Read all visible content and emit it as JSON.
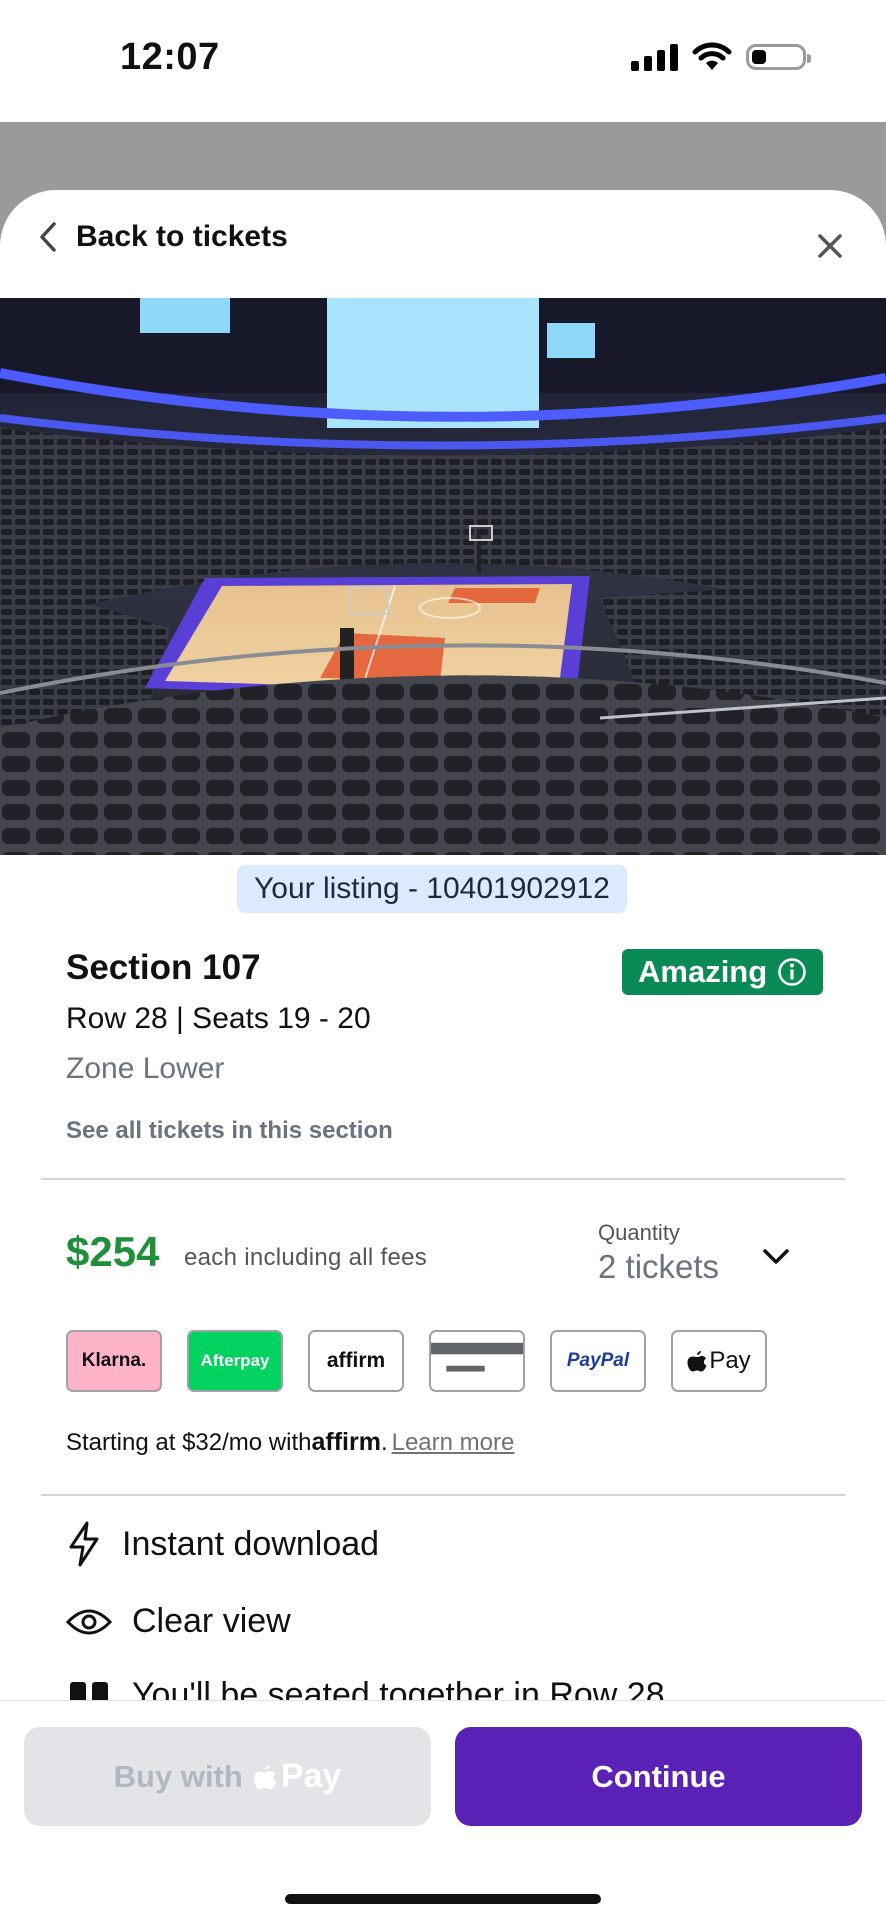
{
  "status_bar": {
    "time": "12:07"
  },
  "header": {
    "back_label": "Back to tickets"
  },
  "listing": {
    "pill_text": "Your listing - 10401902912",
    "section": "Section 107",
    "badge": "Amazing",
    "row_seats": "Row 28 | Seats 19 - 20",
    "zone": "Zone Lower",
    "see_all": "See all tickets in this section"
  },
  "pricing": {
    "price": "$254",
    "fees_note": "each including all fees",
    "quantity_label": "Quantity",
    "quantity_value": "2 tickets"
  },
  "payment_methods": [
    {
      "name": "Klarna",
      "label": "Klarna."
    },
    {
      "name": "Afterpay",
      "label": "Afterpay"
    },
    {
      "name": "Affirm",
      "label": "affirm"
    },
    {
      "name": "Card",
      "label": ""
    },
    {
      "name": "PayPal",
      "label": "PayPal"
    },
    {
      "name": "Apple Pay",
      "label": "Pay"
    }
  ],
  "affirm_promo": {
    "prefix": "Starting at $32/mo with ",
    "brand": "affirm",
    "dot": ". ",
    "learn_more": "Learn more"
  },
  "features": [
    {
      "icon": "lightning-icon",
      "label": "Instant download"
    },
    {
      "icon": "eye-icon",
      "label": "Clear view"
    },
    {
      "icon": "seats-icon",
      "label": "You'll be seated together in Row 28"
    }
  ],
  "actions": {
    "buy_with": "Buy with",
    "apple_pay": "Pay",
    "continue": "Continue"
  },
  "colors": {
    "price_green": "#1f8f3a",
    "badge_green": "#0a8a55",
    "continue_purple": "#5b21b6",
    "pill_blue": "#dbeafe"
  }
}
